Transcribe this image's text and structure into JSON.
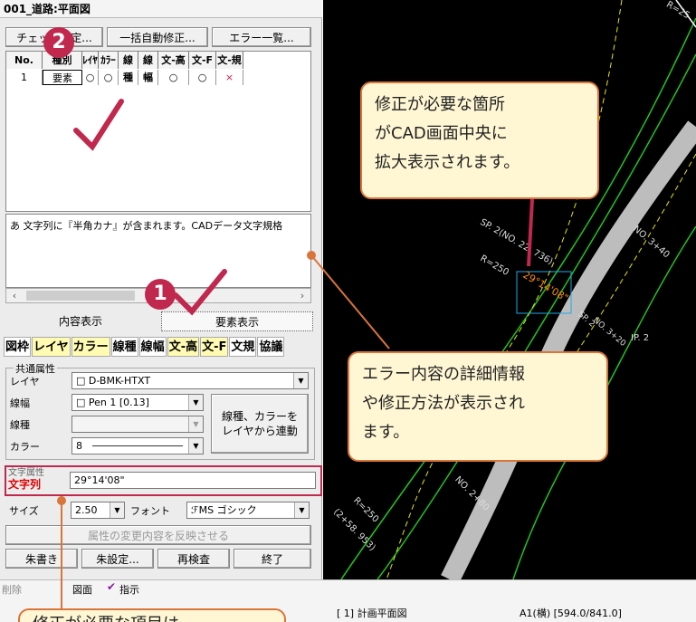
{
  "window_title": "001_道路:平面図",
  "buttons": {
    "check": "チェック設定...",
    "auto_fix": "一括自動修正...",
    "error_list": "エラー一覧..."
  },
  "grid": {
    "headers": [
      "No.",
      "種別",
      "ﾚｲﾔ",
      "ｶﾗｰ",
      "線種",
      "線幅",
      "文-高",
      "文-F",
      "文-規"
    ],
    "row": [
      "1",
      "要素",
      "○",
      "○",
      "－",
      "－",
      "○",
      "○",
      "×"
    ]
  },
  "message": "あ 文字列に『半角カナ』が含まれます。CADデータ文字規格",
  "tabs": {
    "content": "内容表示",
    "element": "要素表示"
  },
  "toolbar_items": [
    "図枠",
    "レイヤ",
    "カラー",
    "線種",
    "線幅",
    "文-高",
    "文-F",
    "文規",
    "協議"
  ],
  "common_attr": {
    "group_title": "共通属性",
    "layer_label": "レイヤ",
    "layer_value": "□ D-BMK-HTXT",
    "width_label": "線幅",
    "width_value": "□ Pen 1   [0.13]",
    "linetype_label": "線種",
    "color_label": "カラー",
    "color_value": "8",
    "link_button": "線種、カラーを\nレイヤから連動"
  },
  "text_attr": {
    "group_title": "文字属性",
    "string_label": "文字列",
    "string_value": "29°14'08\"",
    "size_label": "サイズ",
    "size_value": "2.50",
    "font_label": "フォント",
    "font_value": "ℱMS ゴシック"
  },
  "bottom_buttons": {
    "reflect": "属性の変更内容を反映させる",
    "red_write": "朱書き",
    "red_settings": "朱設定...",
    "recheck": "再検査",
    "finish": "終了"
  },
  "status": {
    "delete": "削除",
    "drawing": "図面",
    "instruction": "指示",
    "plan_name": "[ 1] 計画平面図",
    "paper": "A1(横) [594.0/841.0]"
  },
  "cad_labels": {
    "sp": "SP. 2(NO. 22. 736)",
    "r250": "R=250",
    "angle": "29°14'08\"",
    "ip": "IP. 2",
    "no320": "NO. 3+20",
    "no340": "NO. 3+40",
    "no280": "NO. 2+80",
    "sp_small": "SP. 2",
    "no_small": "NO. 3+20",
    "coord": "(2+58. 953)",
    "r250b": "R=250",
    "top_r": "R=25"
  },
  "callouts": {
    "top": "修正が必要な箇所\nがCAD画面中央に\n拡大表示されます。",
    "middle": "エラー内容の詳細情報\nや修正方法が表示され\nます。",
    "bottom": "修正が必要な項目は"
  },
  "badges": {
    "one": "1",
    "two": "2"
  },
  "colors": {
    "accent": "#c0284e",
    "callout_border": "#d9743a",
    "callout_fill": "#fff7d4",
    "highlight": "#fffbb2"
  }
}
